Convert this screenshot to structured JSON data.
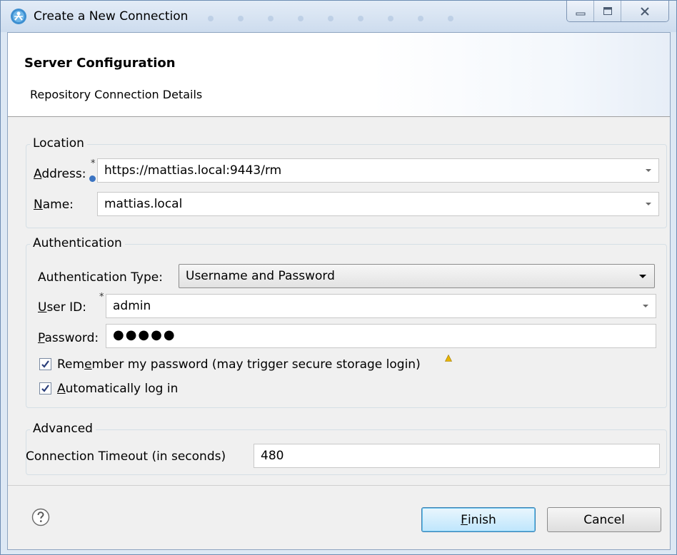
{
  "window": {
    "title": "Create a New Connection",
    "title_icon": "eclipse-connection-icon",
    "controls": [
      "minimize-icon",
      "maximize-icon",
      "close-icon"
    ]
  },
  "header": {
    "title": "Server Configuration",
    "subtitle": "Repository Connection Details"
  },
  "location": {
    "legend": "Location",
    "address_label_pre": "A",
    "address_label_rest": "ddress:",
    "address_value": "https://mattias.local:9443/rm",
    "name_label_pre": "N",
    "name_label_rest": "ame:",
    "name_value": "mattias.local",
    "required_marker": "*"
  },
  "authentication": {
    "legend": "Authentication",
    "type_label": "Authentication Type:",
    "type_value": "Username and Password",
    "userid_label_pre": "U",
    "userid_label_rest": "ser ID:",
    "userid_value": "admin",
    "password_label_pre": "P",
    "password_label_rest": "assword:",
    "password_mask": "●●●●●",
    "remember_pre": "Rem",
    "remember_mn": "e",
    "remember_rest": "mber my password (may trigger secure storage login)",
    "remember_checked": true,
    "autologin_pre": "",
    "autologin_mn": "A",
    "autologin_rest": "utomatically log in",
    "autologin_checked": true,
    "required_marker": "*"
  },
  "advanced": {
    "legend": "Advanced",
    "timeout_label": "Connection Timeout (in seconds)",
    "timeout_value": "480"
  },
  "footer": {
    "finish_mn": "F",
    "finish_rest": "inish",
    "cancel_label": "Cancel",
    "help_icon": "help-icon"
  },
  "colors": {
    "titlebar": "#cddcee",
    "dialog_bg": "#f0f0f0",
    "default_button": "#bee6fd",
    "info_icon": "#3b74c2",
    "warning_icon": "#e8b400"
  }
}
